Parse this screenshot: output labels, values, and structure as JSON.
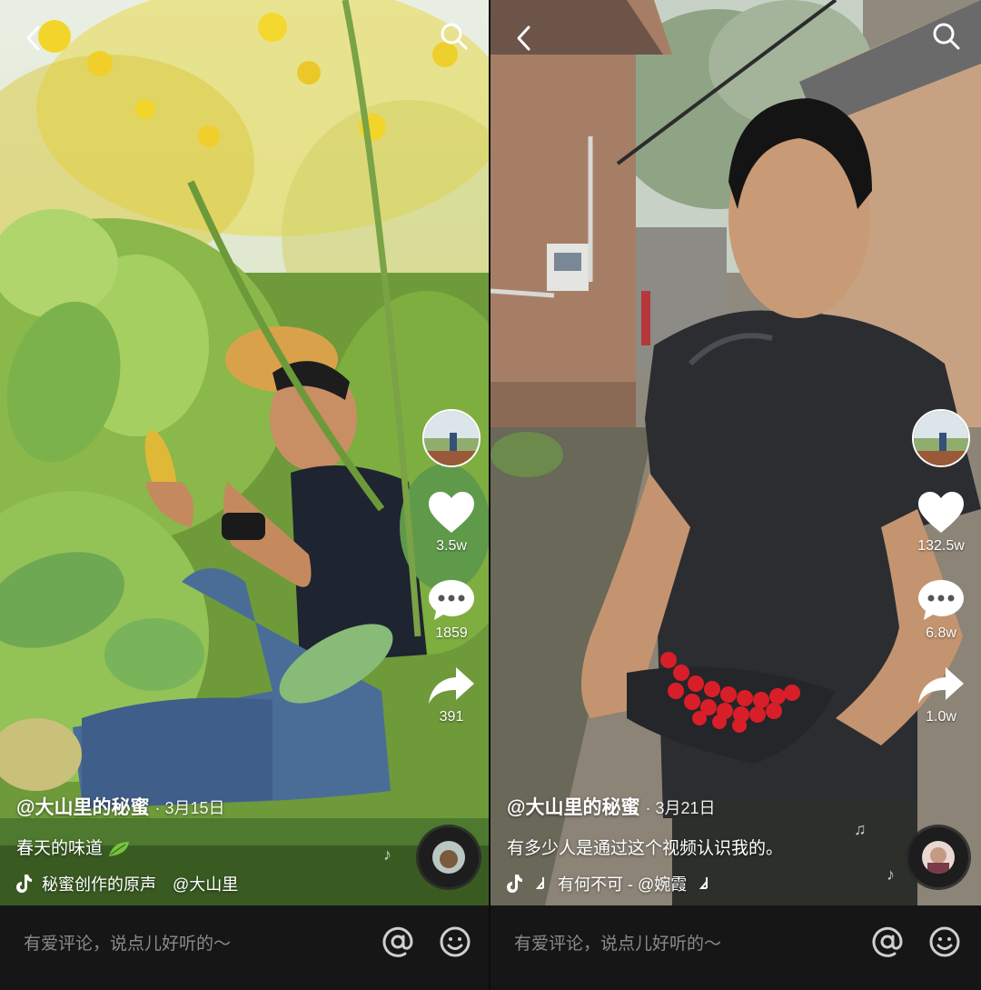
{
  "left": {
    "author": "@大山里的秘蜜",
    "date": "· 3月15日",
    "caption": "春天的味道",
    "music_text": "秘蜜创作的原声　@大山里",
    "likes": "3.5w",
    "comments": "1859",
    "shares": "391",
    "comment_placeholder": "有爱评论，说点儿好听的～"
  },
  "right": {
    "author": "@大山里的秘蜜",
    "date": "· 3月21日",
    "caption": "有多少人是通过这个视频认识我的。",
    "music_text": "有何不可 - @婉霞",
    "likes": "132.5w",
    "comments": "6.8w",
    "shares": "1.0w",
    "comment_placeholder": "有爱评论，说点儿好听的～"
  },
  "icons": {
    "back": "chevron-left-icon",
    "search": "search-icon",
    "like": "heart-icon",
    "comment": "comment-bubble-icon",
    "share": "share-arrow-icon",
    "music": "tiktok-note-icon",
    "mention": "at-icon",
    "emoji": "emoji-icon"
  },
  "colors": {
    "bar_bg": "#161616",
    "text": "#ffffff",
    "placeholder": "#8a8a8a"
  }
}
